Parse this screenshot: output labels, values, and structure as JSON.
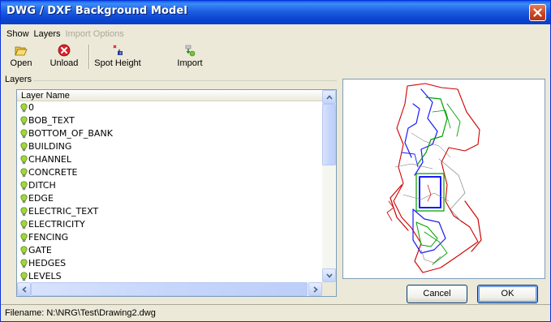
{
  "window": {
    "title": "DWG / DXF Background Model"
  },
  "menu": {
    "show": "Show",
    "layers": "Layers",
    "import_options": "Import Options"
  },
  "toolbar": {
    "open": {
      "label": "Open",
      "icon": "folder-open-icon"
    },
    "unload": {
      "label": "Unload",
      "icon": "red-x-icon"
    },
    "spot_height": {
      "label": "Spot Height",
      "icon": "spot-height-icon"
    },
    "import": {
      "label": "Import",
      "icon": "import-icon"
    }
  },
  "layers_group": {
    "label": "Layers",
    "column_header": "Layer Name",
    "items": [
      {
        "name": "0"
      },
      {
        "name": "BOB_TEXT"
      },
      {
        "name": "BOTTOM_OF_BANK"
      },
      {
        "name": "BUILDING"
      },
      {
        "name": "CHANNEL"
      },
      {
        "name": "CONCRETE"
      },
      {
        "name": "DITCH"
      },
      {
        "name": "EDGE"
      },
      {
        "name": "ELECTRIC_TEXT"
      },
      {
        "name": "ELECTRICITY"
      },
      {
        "name": "FENCING"
      },
      {
        "name": "GATE"
      },
      {
        "name": "HEDGES"
      },
      {
        "name": "LEVELS"
      }
    ],
    "layer_icon": "lightbulb-on-icon",
    "vertical_scroll_fraction": 0.0,
    "horizontal_scroll_fraction": 0.0
  },
  "buttons": {
    "cancel": "Cancel",
    "ok": "OK"
  },
  "status": {
    "filename": "Filename: N:\\NRG\\Test\\Drawing2.dwg"
  },
  "colors": {
    "title_bar": "#0a46d2",
    "dialog_bg": "#ece9d8",
    "layer_bulb": "#9acd32",
    "drawing_red": "#e00000",
    "drawing_blue": "#1a1aff",
    "drawing_green": "#00a000"
  }
}
